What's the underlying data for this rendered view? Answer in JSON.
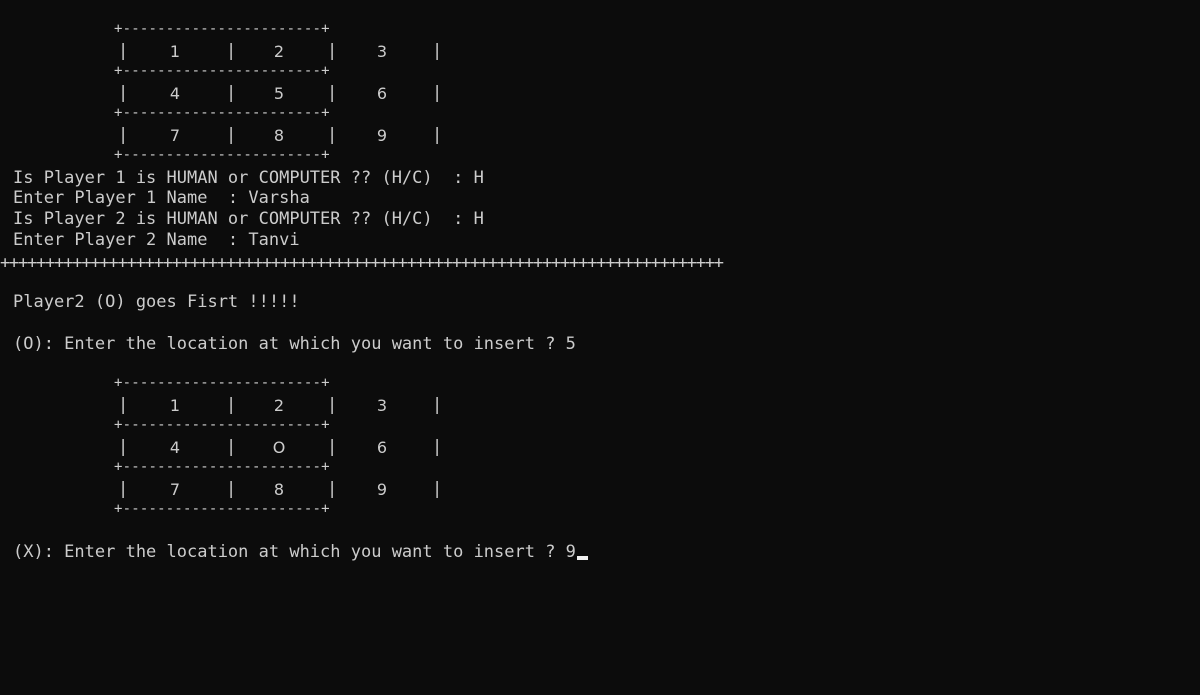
{
  "board1": {
    "rows": [
      [
        "1",
        "2",
        "3"
      ],
      [
        "4",
        "5",
        "6"
      ],
      [
        "7",
        "8",
        "9"
      ]
    ],
    "border": "+-----------------------+",
    "pipe": "|"
  },
  "prompts": {
    "p1_type": "Is Player 1 is HUMAN or COMPUTER ?? (H/C)  : H",
    "p1_name": "Enter Player 1 Name  : Varsha",
    "p2_type": "Is Player 2 is HUMAN or COMPUTER ?? (H/C)  : H",
    "p2_name": "Enter Player 2 Name  : Tanvi"
  },
  "separator": "++++++++++++++++++++++++++++++++++++++++++++++++++++++++++++++++++++++++++++++++",
  "goes_first": "Player2 (O) goes Fisrt !!!!!",
  "move_o": "(O): Enter the location at which you want to insert ? 5",
  "board2": {
    "rows": [
      [
        "1",
        "2",
        "3"
      ],
      [
        "4",
        "O",
        "6"
      ],
      [
        "7",
        "8",
        "9"
      ]
    ],
    "border": "+-----------------------+",
    "pipe": "|"
  },
  "move_x": "(X): Enter the location at which you want to insert ? 9"
}
